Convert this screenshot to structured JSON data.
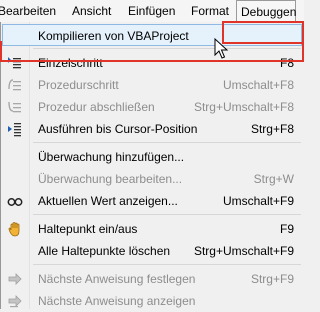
{
  "menubar": {
    "items": [
      {
        "label": "Bearbeiten"
      },
      {
        "label": "Ansicht"
      },
      {
        "label": "Einfügen"
      },
      {
        "label": "Format"
      },
      {
        "label": "Debuggen"
      }
    ]
  },
  "menu": {
    "items": [
      {
        "label": "Kompilieren von VBAProject",
        "shortcut": "",
        "icon": "none",
        "disabled": false
      },
      {
        "label": "Einzelschritt",
        "shortcut": "F8",
        "icon": "step-into-icon",
        "disabled": false
      },
      {
        "label": "Prozedurschritt",
        "shortcut": "Umschalt+F8",
        "icon": "step-over-icon",
        "disabled": true
      },
      {
        "label": "Prozedur abschließen",
        "shortcut": "Strg+Umschalt+F8",
        "icon": "step-out-icon",
        "disabled": true
      },
      {
        "label": "Ausführen bis Cursor-Position",
        "shortcut": "Strg+F8",
        "icon": "run-to-cursor-icon",
        "disabled": false
      },
      {
        "label": "Überwachung hinzufügen...",
        "shortcut": "",
        "icon": "none",
        "disabled": false
      },
      {
        "label": "Überwachung bearbeiten...",
        "shortcut": "Strg+W",
        "icon": "none",
        "disabled": true
      },
      {
        "label": "Aktuellen Wert anzeigen...",
        "shortcut": "Umschalt+F9",
        "icon": "quick-watch-icon",
        "disabled": false
      },
      {
        "label": "Haltepunkt ein/aus",
        "shortcut": "F9",
        "icon": "hand-breakpoint-icon",
        "disabled": false
      },
      {
        "label": "Alle Haltepunkte löschen",
        "shortcut": "Strg+Umschalt+F9",
        "icon": "none",
        "disabled": false
      },
      {
        "label": "Nächste Anweisung festlegen",
        "shortcut": "Strg+F9",
        "icon": "set-next-statement-icon",
        "disabled": true
      },
      {
        "label": "Nächste Anweisung anzeigen",
        "shortcut": "",
        "icon": "show-next-statement-icon",
        "disabled": true
      }
    ]
  },
  "colors": {
    "highlight_border": "#e0342a",
    "selected_bg": "#e5f1fb",
    "disabled_text": "#8d8d8d"
  }
}
